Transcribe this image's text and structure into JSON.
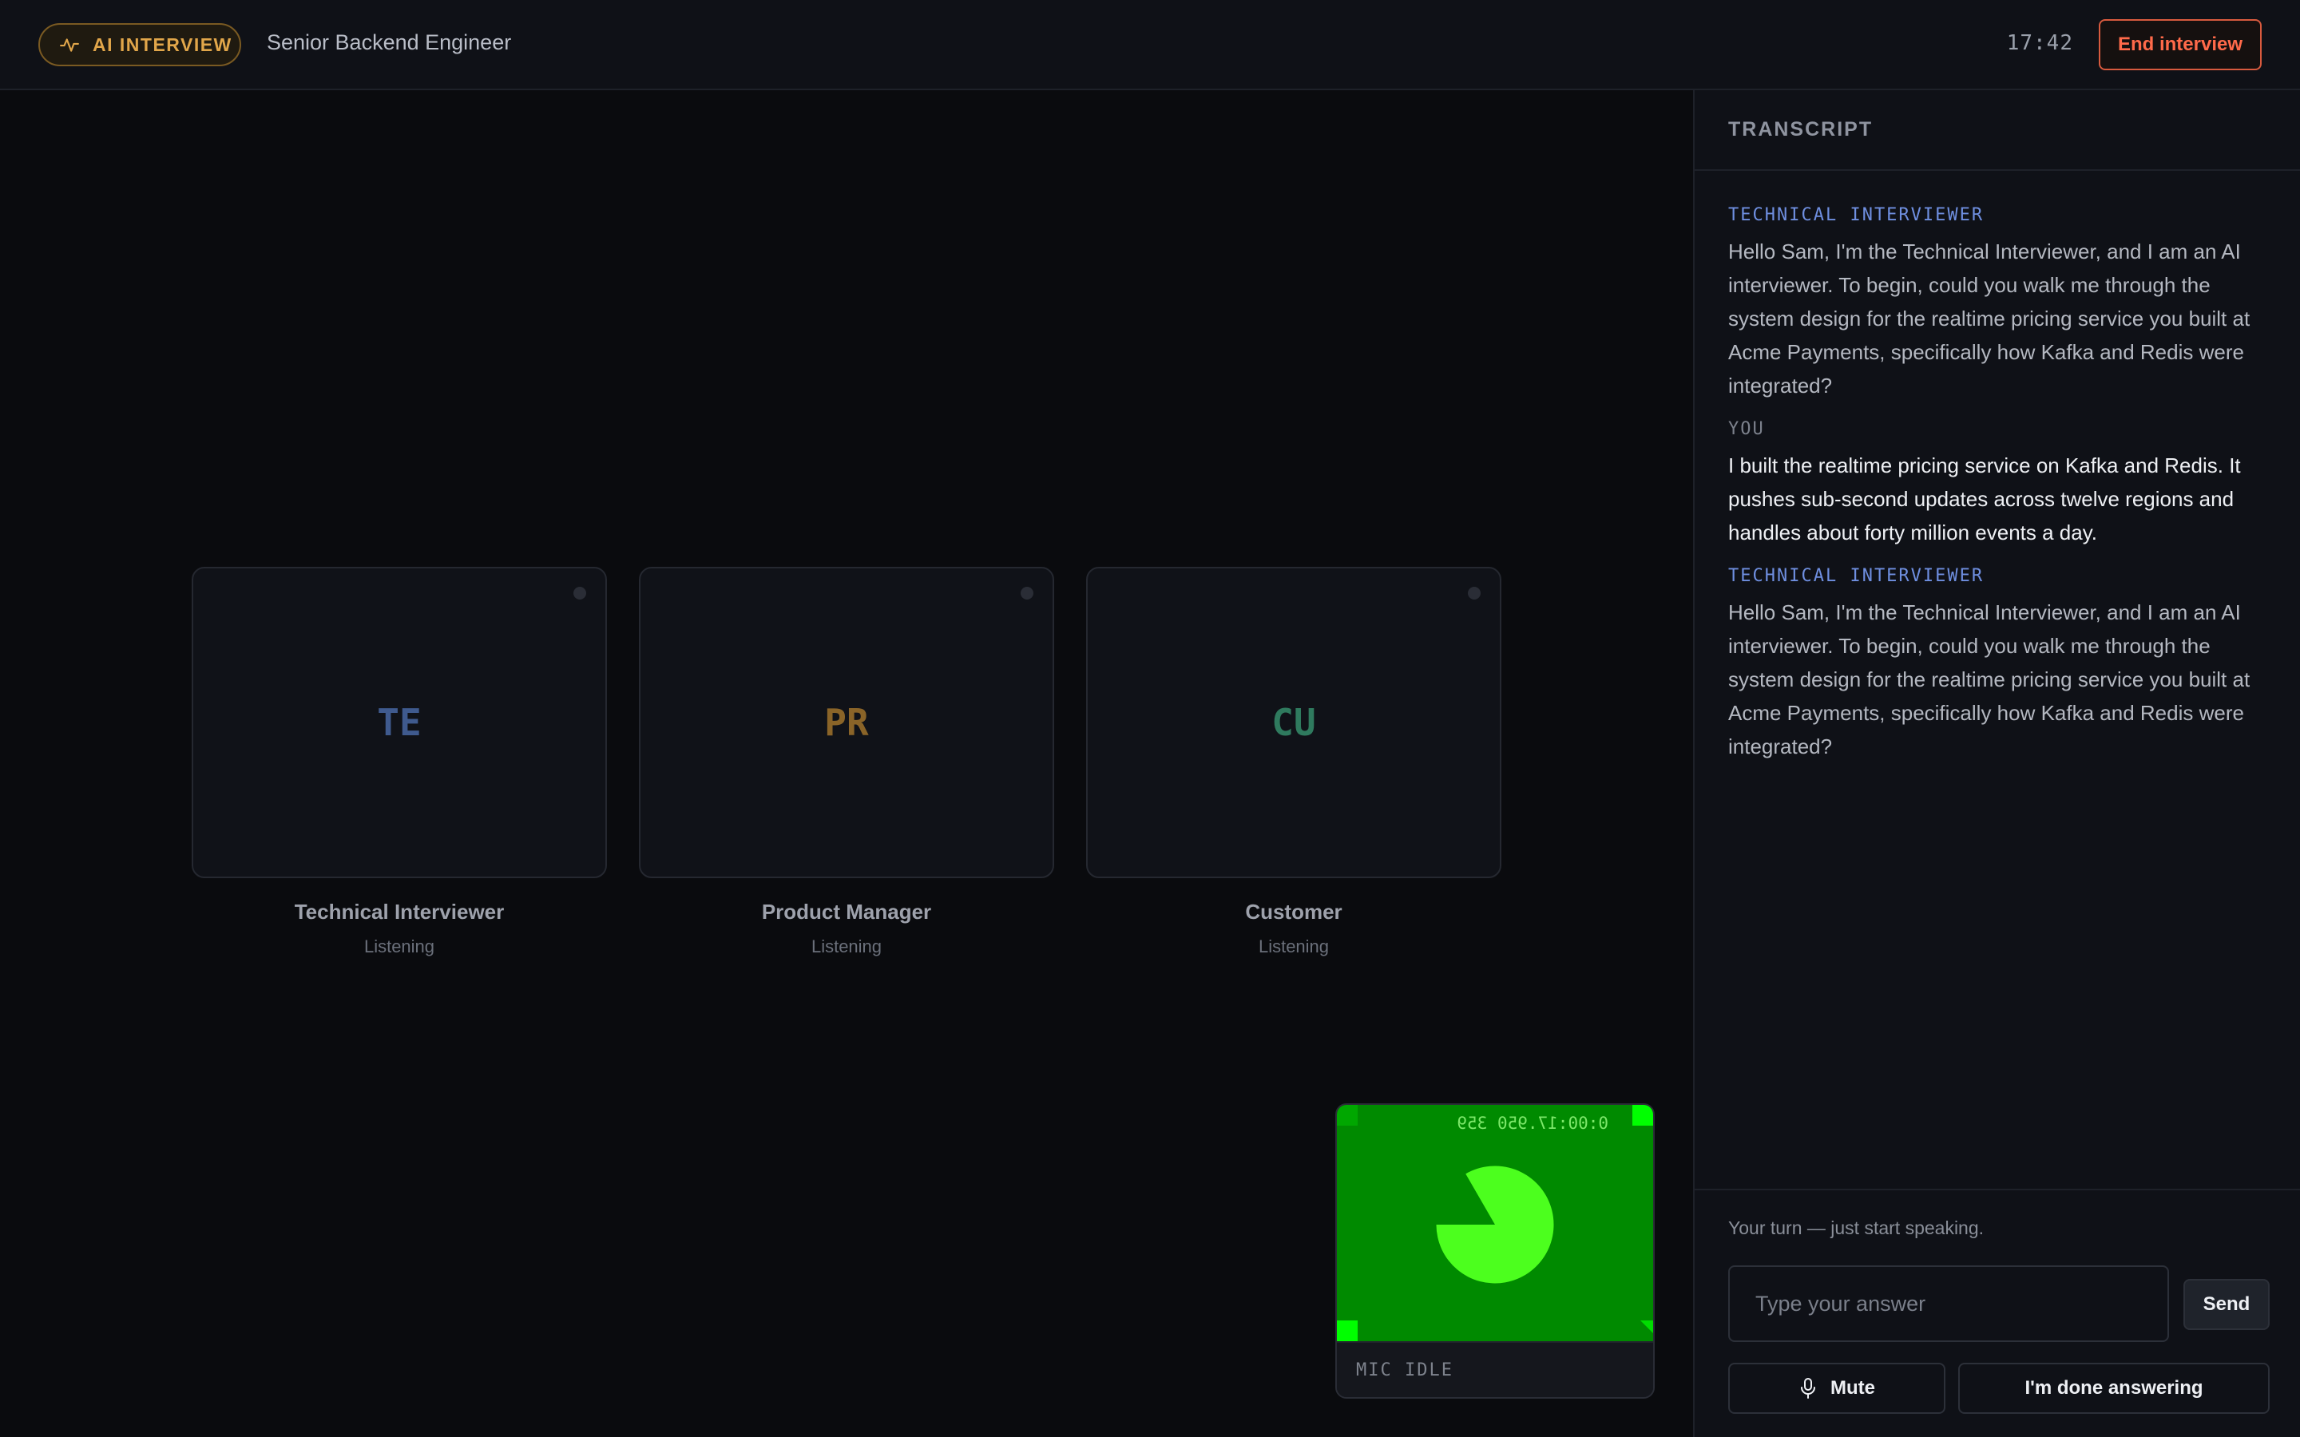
{
  "header": {
    "badge_label": "AI INTERVIEW",
    "role_title": "Senior Backend Engineer",
    "timer": "17:42",
    "end_button_label": "End interview"
  },
  "participants": [
    {
      "initials": "TE",
      "name": "Technical Interviewer",
      "status": "Listening",
      "color": "#3f5a8e"
    },
    {
      "initials": "PR",
      "name": "Product Manager",
      "status": "Listening",
      "color": "#8a6428"
    },
    {
      "initials": "CU",
      "name": "Customer",
      "status": "Listening",
      "color": "#2f7a5e"
    }
  ],
  "mic": {
    "overlay_timestamp": "0:00:17.950 359",
    "caption": "MIC IDLE",
    "video_bg_color": "#008a00",
    "shape_color": "#4cff1e",
    "corner_color": "#00ff00"
  },
  "transcript": {
    "title": "TRANSCRIPT",
    "messages": [
      {
        "speaker": "TECHNICAL INTERVIEWER",
        "text": "Hello Sam, I'm the Technical Interviewer, and I am an AI interviewer. To begin, could you walk me through the system design for the realtime pricing service you built at Acme Payments, specifically how Kafka and Redis were integrated?"
      },
      {
        "speaker": "YOU",
        "text": "I built the realtime pricing service on Kafka and Redis. It pushes sub-second updates across twelve regions and handles about forty million events a day."
      },
      {
        "speaker": "TECHNICAL INTERVIEWER",
        "text": "Hello Sam, I'm the Technical Interviewer, and I am an AI interviewer. To begin, could you walk me through the system design for the realtime pricing service you built at Acme Payments, specifically how Kafka and Redis were integrated?"
      }
    ]
  },
  "footer": {
    "turn_hint": "Your turn — just start speaking.",
    "answer_value": "",
    "answer_placeholder": "Type your answer",
    "send_label": "Send",
    "mute_label": "Mute",
    "done_label": "I'm done answering"
  }
}
